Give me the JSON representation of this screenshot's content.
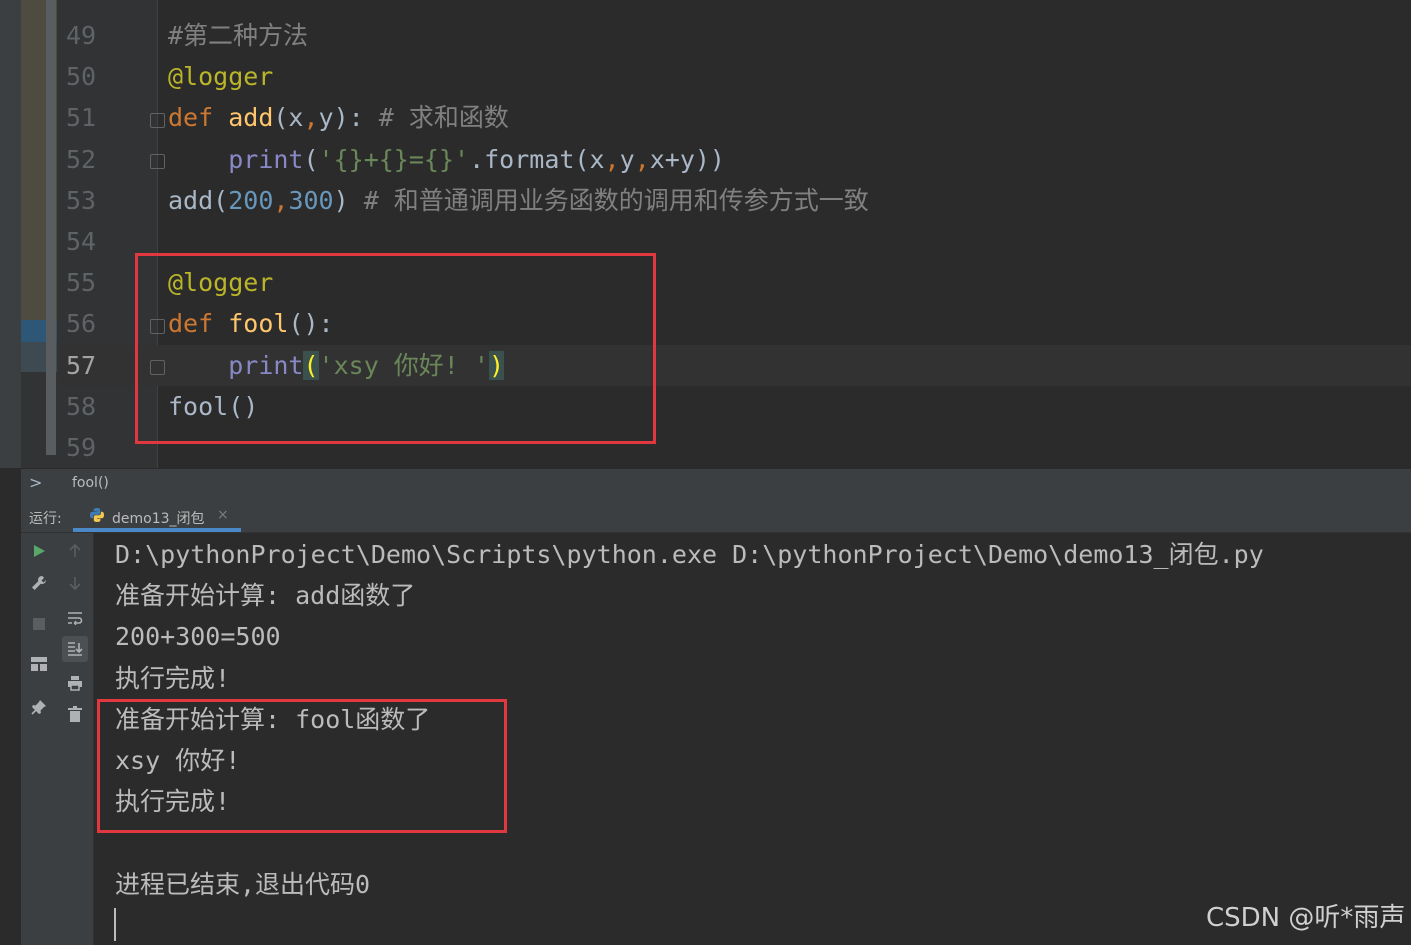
{
  "editor": {
    "lines": [
      {
        "num": "49",
        "tokens": [
          {
            "t": "#第二种方法",
            "c": "comment"
          }
        ]
      },
      {
        "num": "50",
        "tokens": [
          {
            "t": "@logger",
            "c": "deco"
          }
        ]
      },
      {
        "num": "51",
        "tokens": [
          {
            "t": "def ",
            "c": "kw"
          },
          {
            "t": "add",
            "c": "fn"
          },
          {
            "t": "(x",
            "c": "plain"
          },
          {
            "t": ",",
            "c": "kw"
          },
          {
            "t": "y): ",
            "c": "plain"
          },
          {
            "t": "# 求和函数",
            "c": "comment"
          }
        ]
      },
      {
        "num": "52",
        "tokens": [
          {
            "t": "    ",
            "c": "plain"
          },
          {
            "t": "print",
            "c": "builtin"
          },
          {
            "t": "(",
            "c": "plain"
          },
          {
            "t": "'{}+{}={}'",
            "c": "str"
          },
          {
            "t": ".format(x",
            "c": "plain"
          },
          {
            "t": ",",
            "c": "kw"
          },
          {
            "t": "y",
            "c": "plain"
          },
          {
            "t": ",",
            "c": "kw"
          },
          {
            "t": "x+y))",
            "c": "plain"
          }
        ]
      },
      {
        "num": "53",
        "tokens": [
          {
            "t": "add(",
            "c": "plain"
          },
          {
            "t": "200",
            "c": "num"
          },
          {
            "t": ",",
            "c": "kw"
          },
          {
            "t": "300",
            "c": "num"
          },
          {
            "t": ") ",
            "c": "plain"
          },
          {
            "t": "# 和普通调用业务函数的调用和传参方式一致",
            "c": "comment"
          }
        ]
      },
      {
        "num": "54",
        "tokens": []
      },
      {
        "num": "55",
        "tokens": [
          {
            "t": "@logger",
            "c": "deco"
          }
        ]
      },
      {
        "num": "56",
        "tokens": [
          {
            "t": "def ",
            "c": "kw"
          },
          {
            "t": "fool",
            "c": "fn"
          },
          {
            "t": "():",
            "c": "plain"
          }
        ]
      },
      {
        "num": "57",
        "tokens": [
          {
            "t": "    ",
            "c": "plain"
          },
          {
            "t": "print",
            "c": "builtin"
          },
          {
            "t": "(",
            "c": "brace-match"
          },
          {
            "t": "'xsy 你好! '",
            "c": "str"
          },
          {
            "t": ")",
            "c": "brace-match"
          }
        ]
      },
      {
        "num": "58",
        "tokens": [
          {
            "t": "fool()",
            "c": "plain"
          }
        ]
      },
      {
        "num": "59",
        "tokens": []
      }
    ],
    "current_line": "57"
  },
  "breadcrumb": {
    "toggle": ">",
    "text": "fool()"
  },
  "run": {
    "label": "运行:",
    "tab_label": "demo13_闭包",
    "tab_close": "×",
    "console_lines": [
      "D:\\pythonProject\\Demo\\Scripts\\python.exe D:\\pythonProject\\Demo\\demo13_闭包.py",
      "准备开始计算: add函数了",
      "200+300=500",
      "执行完成!",
      "准备开始计算: fool函数了",
      "xsy 你好!",
      "执行完成!",
      "",
      "进程已结束,退出代码0"
    ]
  },
  "toolbar_icons": [
    "run-icon",
    "wrench-icon",
    "stop-icon",
    "layout-icon",
    "pin-icon",
    "up-arrow-icon",
    "down-arrow-icon",
    "soft-wrap-icon",
    "scroll-to-end-icon",
    "print-icon",
    "trash-icon"
  ],
  "watermark": "CSDN @听*雨声",
  "colors": {
    "highlight_box": "#e0383e",
    "accent": "#4a88c7"
  }
}
